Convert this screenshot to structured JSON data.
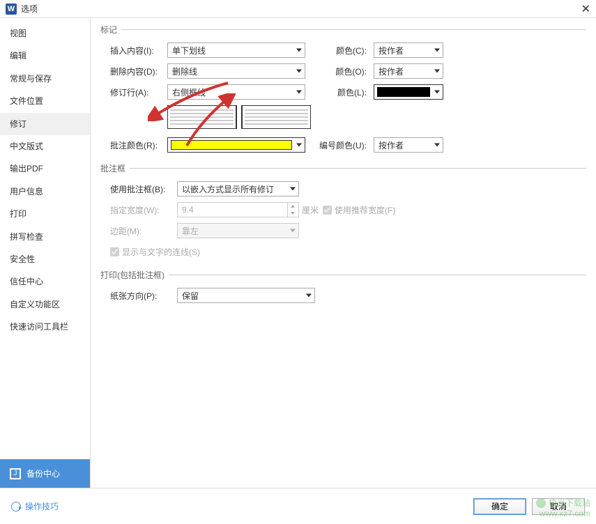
{
  "window": {
    "title": "选项",
    "close_icon": "✕"
  },
  "sidebar": {
    "items": [
      {
        "label": "视图"
      },
      {
        "label": "编辑"
      },
      {
        "label": "常规与保存"
      },
      {
        "label": "文件位置"
      },
      {
        "label": "修订",
        "active": true
      },
      {
        "label": "中文版式"
      },
      {
        "label": "输出PDF"
      },
      {
        "label": "用户信息"
      },
      {
        "label": "打印"
      },
      {
        "label": "拼写检查"
      },
      {
        "label": "安全性"
      },
      {
        "label": "信任中心"
      },
      {
        "label": "自定义功能区"
      },
      {
        "label": "快速访问工具栏"
      }
    ],
    "backup_label": "备份中心"
  },
  "section_marking": {
    "legend": "标记",
    "insert_label": "插入内容(I):",
    "insert_value": "单下划线",
    "insert_color_label": "颜色(C):",
    "insert_color_value": "按作者",
    "delete_label": "删除内容(D):",
    "delete_value": "删除线",
    "delete_color_label": "颜色(O):",
    "delete_color_value": "按作者",
    "revline_label": "修订行(A):",
    "revline_value": "右侧框线",
    "revline_color_label": "颜色(L):",
    "revline_color_value": "#000000",
    "comment_color_label": "批注颜色(R):",
    "comment_color_value": "#ffff00",
    "number_color_label": "编号颜色(U):",
    "number_color_value": "按作者"
  },
  "section_balloon": {
    "legend": "批注框",
    "use_label": "使用批注框(B):",
    "use_value": "以嵌入方式显示所有修订",
    "width_label": "指定宽度(W):",
    "width_value": "9.4",
    "width_unit": "厘米",
    "reco_label": "使用推荐宽度(F)",
    "margin_label": "边距(M):",
    "margin_value": "靠左",
    "showline_label": "显示与文字的连线(S)"
  },
  "section_print": {
    "legend": "打印(包括批注框)",
    "orient_label": "纸张方向(P):",
    "orient_value": "保留"
  },
  "footer": {
    "tips_label": "操作技巧",
    "ok_label": "确定",
    "cancel_label": "取消"
  },
  "watermark": {
    "line1": "极光下载站",
    "line2": "www.xz7.com"
  }
}
